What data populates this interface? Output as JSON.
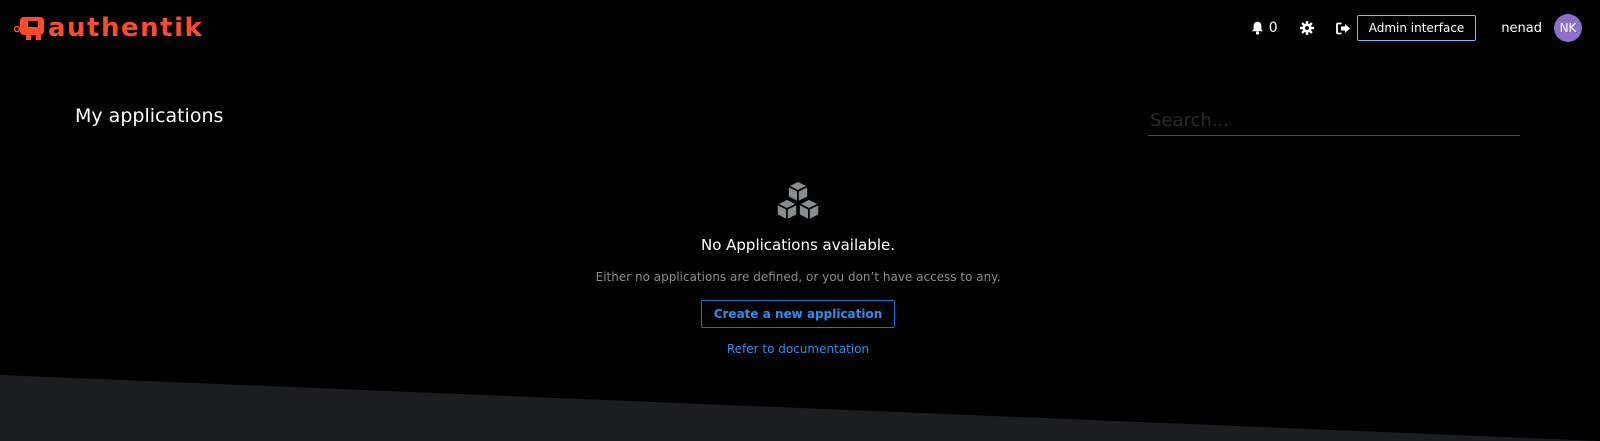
{
  "brand": {
    "name": "authentik",
    "logo_icon": "authentik-logo-icon",
    "color": "#fd4b2d"
  },
  "header": {
    "notifications": {
      "icon": "bell-icon",
      "count": "0"
    },
    "settings_icon": "gear-icon",
    "logout_icon": "sign-out-icon",
    "admin_label": "Admin interface",
    "username": "nenad",
    "avatar_initials": "NK",
    "avatar_color": "#8d6ecb"
  },
  "main": {
    "title": "My applications",
    "search_placeholder": "Search...",
    "empty_state": {
      "icon": "cubes-icon",
      "title": "No Applications available.",
      "body": "Either no applications are defined, or you don’t have access to any.",
      "create_label": "Create a new application",
      "docs_label": "Refer to documentation"
    }
  },
  "colors": {
    "background": "#000000",
    "wedge": "#1b1d21",
    "link": "#2b8ef0",
    "search_underline": "#c9190b"
  }
}
